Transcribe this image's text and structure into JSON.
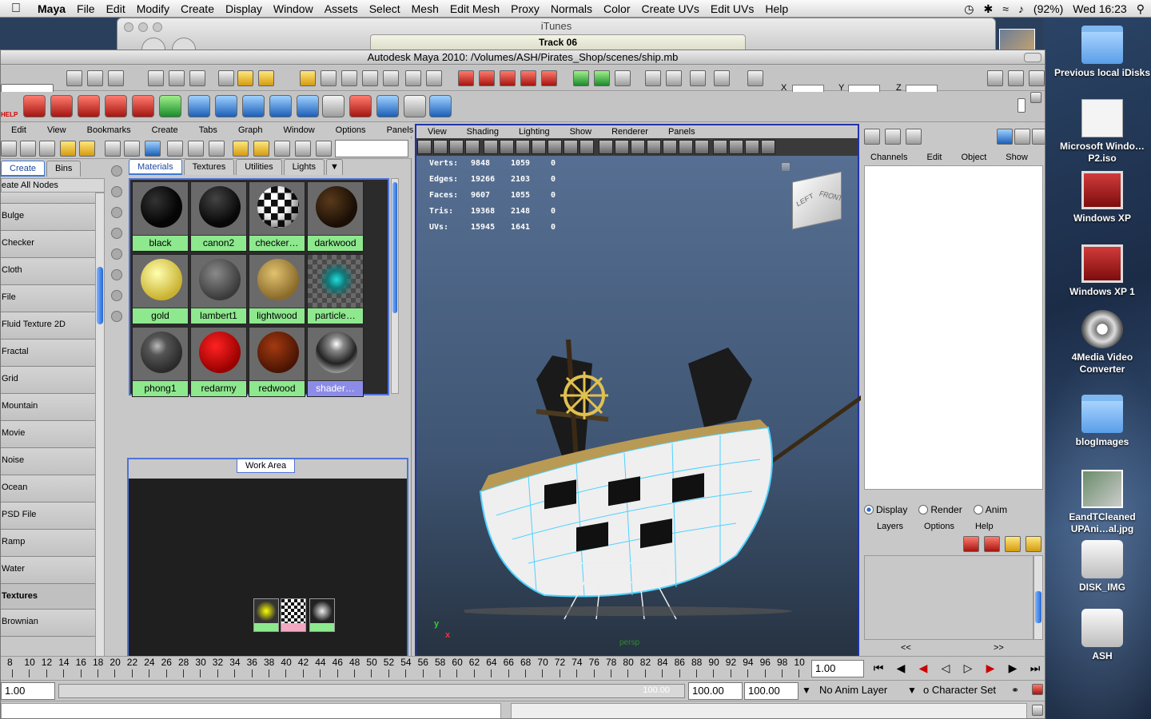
{
  "menubar": {
    "app": "Maya",
    "items": [
      "File",
      "Edit",
      "Modify",
      "Create",
      "Display",
      "Window",
      "Assets",
      "Select",
      "Mesh",
      "Edit Mesh",
      "Proxy",
      "Normals",
      "Color",
      "Create UVs",
      "Edit UVs",
      "Help"
    ],
    "battery": "(92%)",
    "clock": "Wed 16:23"
  },
  "itunes": {
    "title": "iTunes",
    "track": "Track 06"
  },
  "maya": {
    "title": "Autodesk Maya 2010: /Volumes/ASH/Pirates_Shop/scenes/ship.mb",
    "xyz": {
      "x": "X",
      "y": "Y",
      "z": "Z"
    },
    "help_icon": "HELP"
  },
  "hypershade": {
    "menu": [
      "Edit",
      "View",
      "Bookmarks",
      "Create",
      "Tabs",
      "Graph",
      "Window",
      "Options",
      "Panels"
    ],
    "left_tabs": [
      "Create",
      "Bins"
    ],
    "all_nodes": "eate All Nodes",
    "nodes": [
      "Bulge",
      "Checker",
      "Cloth",
      "File",
      "Fluid Texture 2D",
      "Fractal",
      "Grid",
      "Mountain",
      "Movie",
      "Noise",
      "Ocean",
      "PSD File",
      "Ramp",
      "Water"
    ],
    "section": "Textures",
    "section_first": "Brownian",
    "page_prev": "<<",
    "page_next": ">>",
    "mat_tabs": [
      "Materials",
      "Textures",
      "Utilities",
      "Lights"
    ],
    "materials": [
      "black",
      "canon2",
      "checker…",
      "darkwood",
      "gold",
      "lambert1",
      "lightwood",
      "particle…",
      "phong1",
      "redarmy",
      "redwood",
      "shader…"
    ],
    "work_area_tab": "Work Area"
  },
  "viewport": {
    "menu": [
      "View",
      "Shading",
      "Lighting",
      "Show",
      "Renderer",
      "Panels"
    ],
    "stats": [
      {
        "k": "Verts:",
        "a": "9848",
        "b": "1059",
        "c": "0"
      },
      {
        "k": "Edges:",
        "a": "19266",
        "b": "2103",
        "c": "0"
      },
      {
        "k": "Faces:",
        "a": "9607",
        "b": "1055",
        "c": "0"
      },
      {
        "k": "Tris:",
        "a": "19368",
        "b": "2148",
        "c": "0"
      },
      {
        "k": "UVs:",
        "a": "15945",
        "b": "1641",
        "c": "0"
      }
    ],
    "cube_left": "LEFT",
    "cube_front": "FRONT",
    "camera": "persp",
    "axis_y": "y",
    "axis_x": "x"
  },
  "channelbox": {
    "menu": [
      "Channels",
      "Edit",
      "Object",
      "Show"
    ],
    "radios": [
      "Display",
      "Render",
      "Anim"
    ],
    "layer_menu": [
      "Layers",
      "Options",
      "Help"
    ],
    "page_prev": "<<",
    "page_next": ">>"
  },
  "timeline": {
    "ticks": [
      "8",
      "10",
      "12",
      "14",
      "16",
      "18",
      "20",
      "22",
      "24",
      "26",
      "28",
      "30",
      "32",
      "34",
      "36",
      "38",
      "40",
      "42",
      "44",
      "46",
      "48",
      "50",
      "52",
      "54",
      "56",
      "58",
      "60",
      "62",
      "64",
      "66",
      "68",
      "70",
      "72",
      "74",
      "76",
      "78",
      "80",
      "82",
      "84",
      "86",
      "88",
      "90",
      "92",
      "94",
      "96",
      "98",
      "10"
    ],
    "current": "1.00"
  },
  "range": {
    "start": "1.00",
    "bar_end": "100.00",
    "end1": "100.00",
    "end2": "100.00",
    "anim_layer": "No Anim Layer",
    "char_set": "o Character Set"
  },
  "desktop": [
    {
      "label": "Previous local iDisks",
      "kind": "folder"
    },
    {
      "label": "Microsoft Windo…P2.iso",
      "kind": "doc"
    },
    {
      "label": "Windows XP",
      "kind": "par"
    },
    {
      "label": "Windows XP 1",
      "kind": "par"
    },
    {
      "label": "4Media Video Converter",
      "kind": "reel"
    },
    {
      "label": "blogImages",
      "kind": "folder"
    },
    {
      "label": "EandTCleaned UPAni…al.jpg",
      "kind": "img"
    },
    {
      "label": "DISK_IMG",
      "kind": "drive"
    },
    {
      "label": "ASH",
      "kind": "drive"
    }
  ]
}
